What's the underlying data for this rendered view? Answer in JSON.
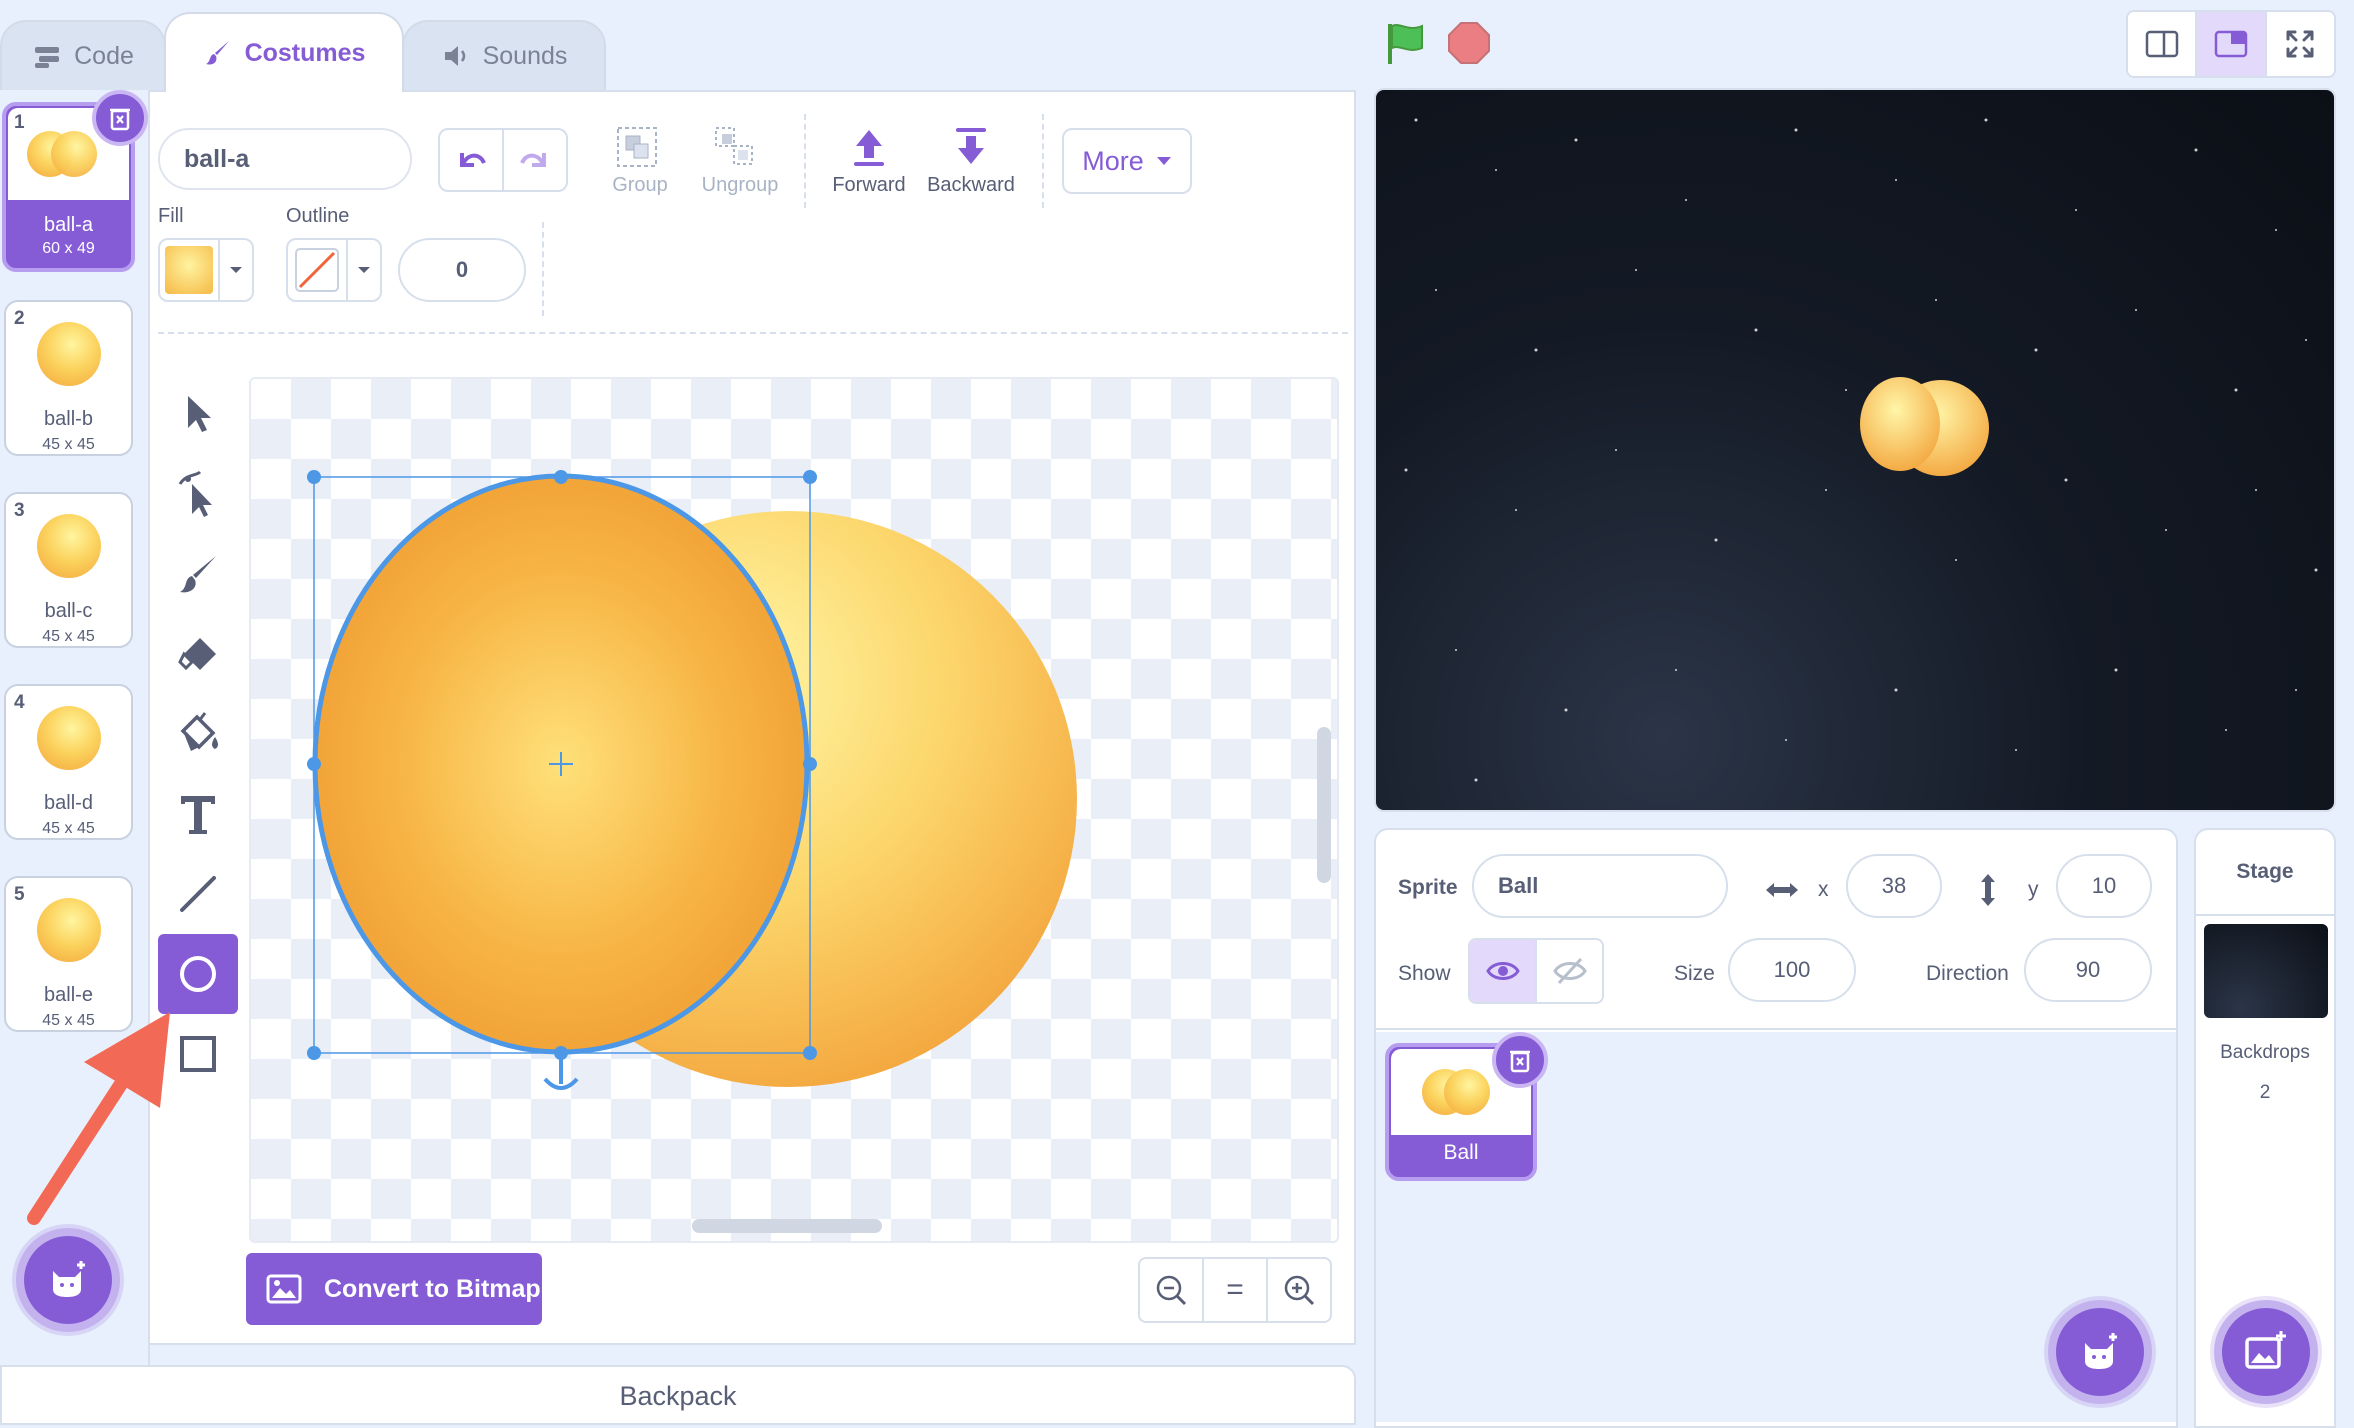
{
  "tabs": [
    {
      "label": "Code",
      "icon": "code-icon"
    },
    {
      "label": "Costumes",
      "icon": "brush-icon"
    },
    {
      "label": "Sounds",
      "icon": "speaker-icon"
    }
  ],
  "costumes": [
    {
      "num": "1",
      "name": "ball-a",
      "size": "60 x 49"
    },
    {
      "num": "2",
      "name": "ball-b",
      "size": "45 x 45"
    },
    {
      "num": "3",
      "name": "ball-c",
      "size": "45 x 45"
    },
    {
      "num": "4",
      "name": "ball-d",
      "size": "45 x 45"
    },
    {
      "num": "5",
      "name": "ball-e",
      "size": "45 x 45"
    }
  ],
  "editor": {
    "costume_name": "ball-a",
    "group": "Group",
    "ungroup": "Ungroup",
    "forward": "Forward",
    "backward": "Backward",
    "more": "More",
    "fill_label": "Fill",
    "outline_label": "Outline",
    "outline_width": "0",
    "convert_label": "Convert to Bitmap",
    "zoom_reset": "="
  },
  "backpack": "Backpack",
  "sprite": {
    "label": "Sprite",
    "name": "Ball",
    "x_label": "x",
    "x": "38",
    "y_label": "y",
    "y": "10",
    "show_label": "Show",
    "size_label": "Size",
    "size": "100",
    "direction_label": "Direction",
    "direction": "90",
    "tile_name": "Ball"
  },
  "stage_pane": {
    "title": "Stage",
    "backdrops_label": "Backdrops",
    "backdrops_count": "2"
  },
  "colors": {
    "accent": "#855cd6",
    "annotation_arrow": "#f26a55",
    "flag": "#4cbf56",
    "stop": "#ec5959"
  }
}
